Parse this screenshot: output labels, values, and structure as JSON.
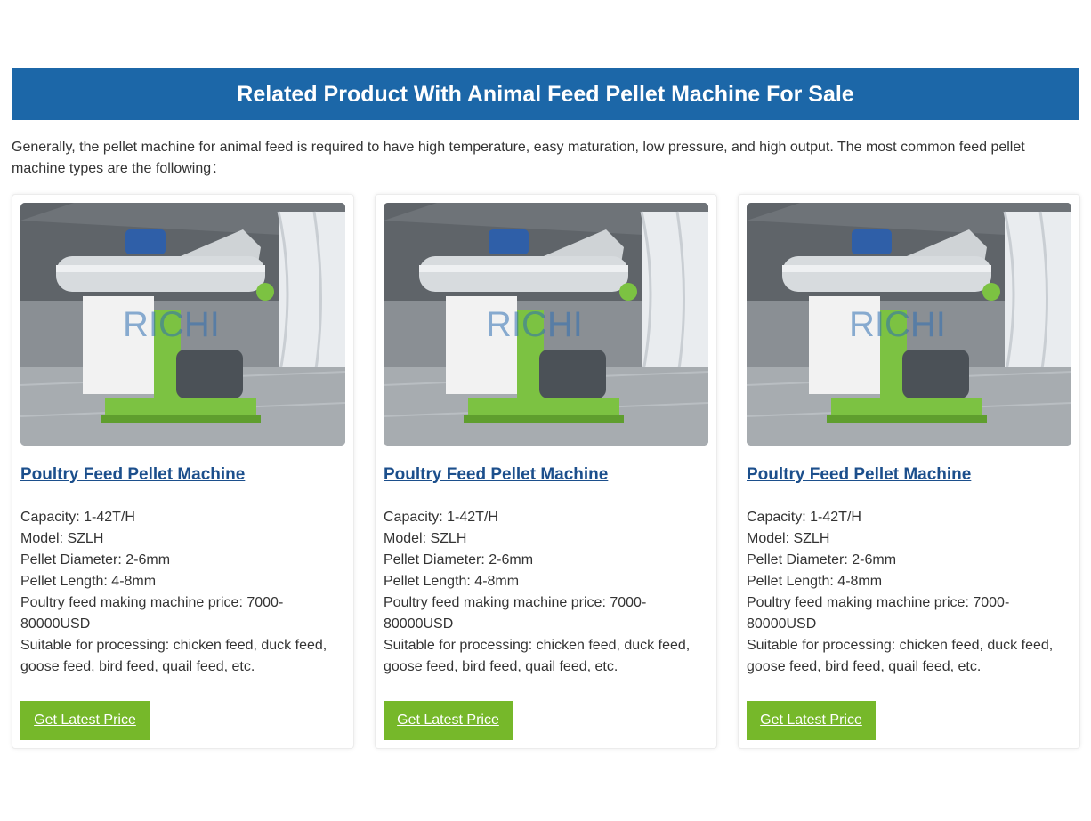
{
  "section": {
    "heading": "Related Product With Animal Feed Pellet Machine For Sale",
    "intro": "Generally, the pellet machine for animal feed is required to have high temperature, easy maturation, low pressure, and high output. The most common feed pellet machine types are the following："
  },
  "colors": {
    "banner": "#1c67a8",
    "title_link": "#1c4f8c",
    "button": "#76b82a"
  },
  "products": [
    {
      "image_alt": "poultry feed pellet machine",
      "watermark": "RICHI",
      "title": "Poultry Feed Pellet Machine",
      "specs": [
        "Capacity: 1-42T/H",
        "Model: SZLH",
        "Pellet Diameter: 2-6mm",
        "Pellet Length: 4-8mm",
        "Poultry feed making machine price: 7000-80000USD",
        "Suitable for processing: chicken feed, duck feed, goose feed, bird feed, quail feed, etc."
      ],
      "button": "Get Latest Price"
    },
    {
      "image_alt": "poultry feed pellet machine",
      "watermark": "RICHI",
      "title": "Poultry Feed Pellet Machine",
      "specs": [
        "Capacity: 1-42T/H",
        "Model: SZLH",
        "Pellet Diameter: 2-6mm",
        "Pellet Length: 4-8mm",
        "Poultry feed making machine price: 7000-80000USD",
        "Suitable for processing: chicken feed, duck feed, goose feed, bird feed, quail feed, etc."
      ],
      "button": "Get Latest Price"
    },
    {
      "image_alt": "poultry feed pellet machine",
      "watermark": "RICHI",
      "title": "Poultry Feed Pellet Machine",
      "specs": [
        "Capacity: 1-42T/H",
        "Model: SZLH",
        "Pellet Diameter: 2-6mm",
        "Pellet Length: 4-8mm",
        "Poultry feed making machine price: 7000-80000USD",
        "Suitable for processing: chicken feed, duck feed, goose feed, bird feed, quail feed, etc."
      ],
      "button": "Get Latest Price"
    }
  ]
}
